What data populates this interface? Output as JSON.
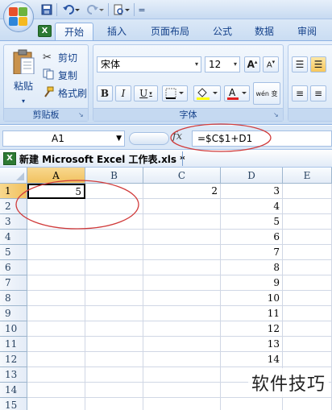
{
  "quick_access": {
    "customize_symbol": "="
  },
  "tabs": [
    {
      "label": "开始",
      "active": true
    },
    {
      "label": "插入"
    },
    {
      "label": "页面布局"
    },
    {
      "label": "公式"
    },
    {
      "label": "数据"
    },
    {
      "label": "审阅"
    }
  ],
  "clipboard": {
    "paste_label": "粘贴",
    "cut_label": "剪切",
    "copy_label": "复制",
    "format_painter_label": "格式刷",
    "group_label": "剪贴板"
  },
  "font": {
    "family": "宋体",
    "size": "12",
    "bold": "B",
    "italic": "I",
    "underline": "U",
    "phonetic": "wén 变",
    "group_label": "字体"
  },
  "formula_bar": {
    "name_box": "A1",
    "fx": "fx",
    "formula": "=$C$1+D1"
  },
  "workbook": {
    "title": "新建 Microsoft Excel 工作表.xls *"
  },
  "sheet": {
    "columns": [
      "A",
      "B",
      "C",
      "D",
      "E"
    ],
    "rows": [
      "1",
      "2",
      "3",
      "4",
      "5",
      "6",
      "7",
      "8",
      "9",
      "10",
      "11",
      "12",
      "13",
      "14",
      "15"
    ],
    "cells": {
      "A1": "5",
      "C1": "2",
      "D": [
        "3",
        "4",
        "5",
        "6",
        "7",
        "8",
        "9",
        "10",
        "11",
        "12",
        "13",
        "14"
      ]
    }
  },
  "annotation_color": "#d03a3a",
  "watermark": "软件技巧"
}
